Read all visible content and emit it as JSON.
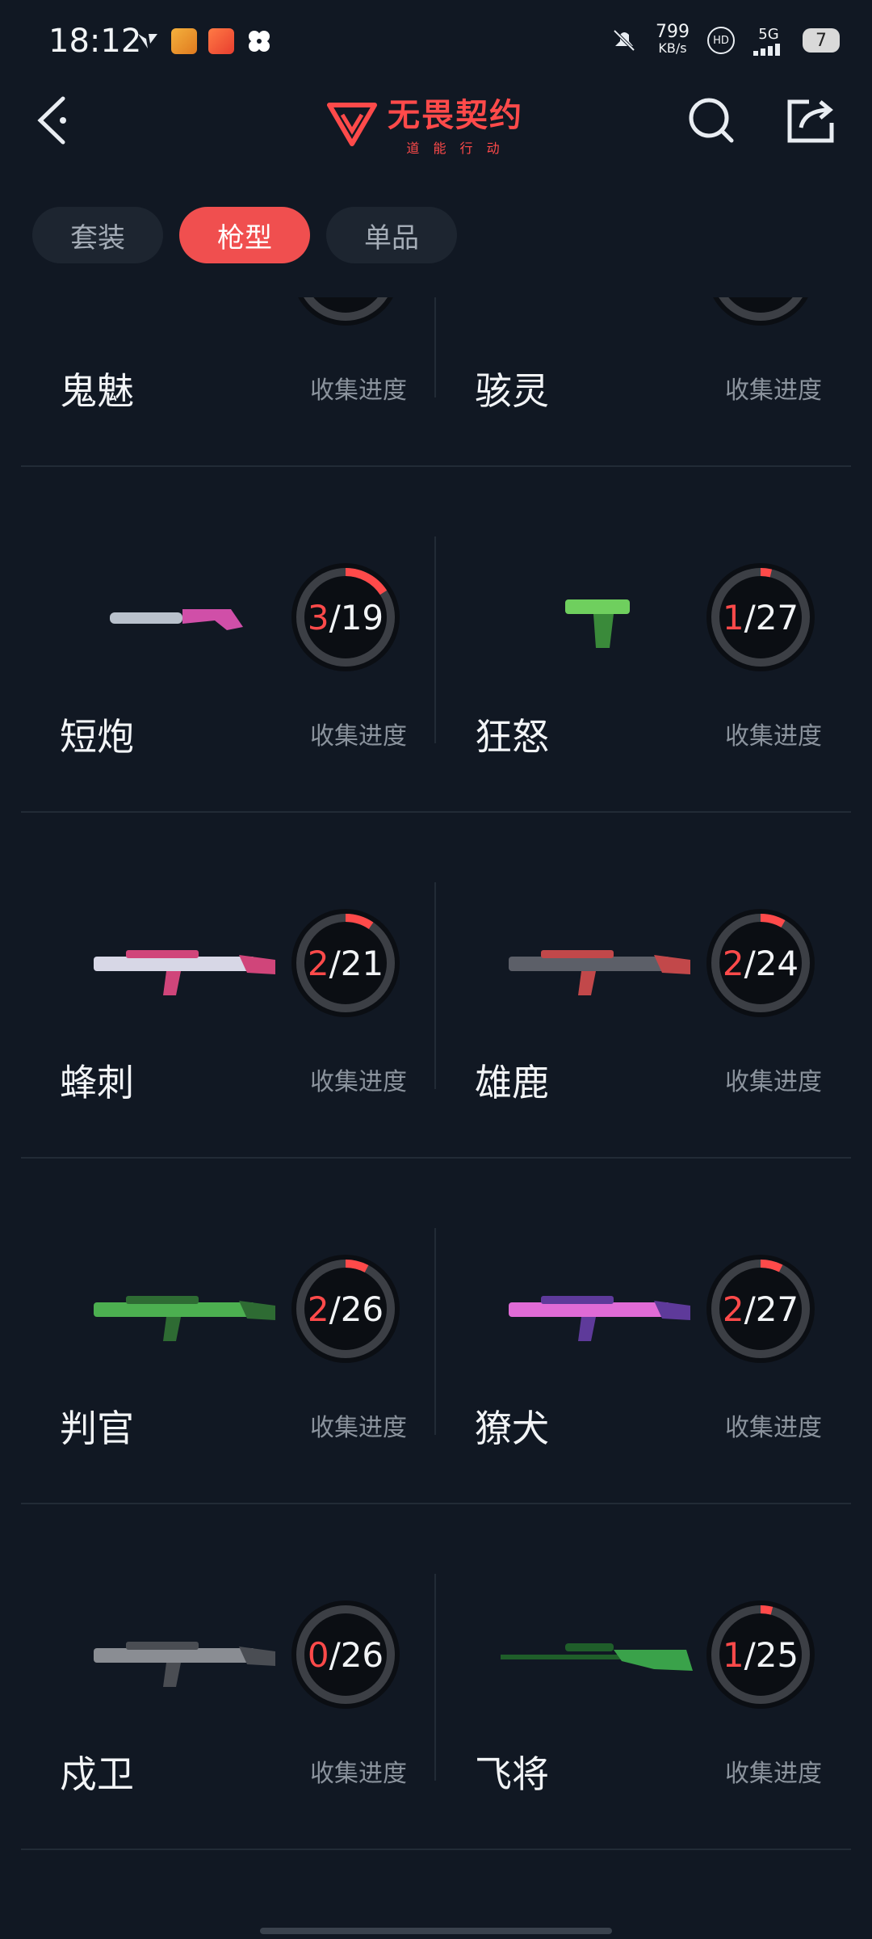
{
  "status_bar": {
    "time": "18:12",
    "net_speed_value": "799",
    "net_speed_unit": "KB/s",
    "hd_label": "HD",
    "signal_label": "5G",
    "battery_level": "7"
  },
  "header": {
    "logo_title": "无畏契约",
    "logo_subtitle": "道 能 行 动",
    "back_icon": "back-arrow-icon",
    "search_icon": "search-icon",
    "share_icon": "share-icon"
  },
  "tabs": [
    {
      "label": "套装",
      "active": false
    },
    {
      "label": "枪型",
      "active": true
    },
    {
      "label": "单品",
      "active": false
    }
  ],
  "progress_label": "收集进度",
  "weapons": [
    {
      "name": "鬼魅",
      "collected": null,
      "total": null
    },
    {
      "name": "骇灵",
      "collected": null,
      "total": null
    },
    {
      "name": "短炮",
      "collected": 3,
      "total": 19
    },
    {
      "name": "狂怒",
      "collected": 1,
      "total": 27
    },
    {
      "name": "蜂刺",
      "collected": 2,
      "total": 21
    },
    {
      "name": "雄鹿",
      "collected": 2,
      "total": 24
    },
    {
      "name": "判官",
      "collected": 2,
      "total": 26
    },
    {
      "name": "獠犬",
      "collected": 2,
      "total": 27
    },
    {
      "name": "戍卫",
      "collected": 0,
      "total": 26
    },
    {
      "name": "飞将",
      "collected": 1,
      "total": 25
    }
  ],
  "colors": {
    "accent": "#f04f4f",
    "background": "#111823",
    "ring_track": "#3c3f45",
    "ring_progress": "#ff4a4a"
  }
}
